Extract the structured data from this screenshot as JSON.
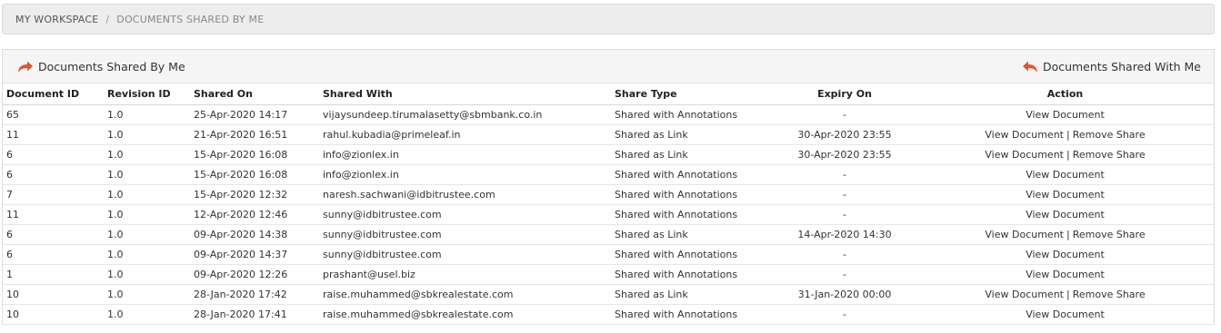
{
  "breadcrumb": {
    "home": "MY WORKSPACE",
    "separator": "/",
    "current": "DOCUMENTS SHARED BY ME"
  },
  "header": {
    "left_label": "Documents Shared By Me",
    "right_label": "Documents Shared With Me",
    "left_icon": "share-forward-icon",
    "right_icon": "share-back-icon",
    "icon_color": "#e8532b"
  },
  "table": {
    "columns": [
      "Document ID",
      "Revision ID",
      "Shared On",
      "Shared With",
      "Share Type",
      "Expiry On",
      "Action"
    ],
    "rows": [
      {
        "doc_id": "65",
        "rev": "1.0",
        "shared_on": "25-Apr-2020 14:17",
        "shared_with": "vijaysundeep.tirumalasetty@sbmbank.co.in",
        "type": "Shared with Annotations",
        "expiry": "-",
        "actions": [
          "View Document"
        ]
      },
      {
        "doc_id": "11",
        "rev": "1.0",
        "shared_on": "21-Apr-2020 16:51",
        "shared_with": "rahul.kubadia@primeleaf.in",
        "type": "Shared as Link",
        "expiry": "30-Apr-2020 23:55",
        "actions": [
          "View Document",
          "Remove Share"
        ]
      },
      {
        "doc_id": "6",
        "rev": "1.0",
        "shared_on": "15-Apr-2020 16:08",
        "shared_with": "info@zionlex.in",
        "type": "Shared as Link",
        "expiry": "30-Apr-2020 23:55",
        "actions": [
          "View Document",
          "Remove Share"
        ]
      },
      {
        "doc_id": "6",
        "rev": "1.0",
        "shared_on": "15-Apr-2020 16:08",
        "shared_with": "info@zionlex.in",
        "type": "Shared with Annotations",
        "expiry": "-",
        "actions": [
          "View Document"
        ]
      },
      {
        "doc_id": "7",
        "rev": "1.0",
        "shared_on": "15-Apr-2020 12:32",
        "shared_with": "naresh.sachwani@idbitrustee.com",
        "type": "Shared with Annotations",
        "expiry": "-",
        "actions": [
          "View Document"
        ]
      },
      {
        "doc_id": "11",
        "rev": "1.0",
        "shared_on": "12-Apr-2020 12:46",
        "shared_with": "sunny@idbitrustee.com",
        "type": "Shared with Annotations",
        "expiry": "-",
        "actions": [
          "View Document"
        ]
      },
      {
        "doc_id": "6",
        "rev": "1.0",
        "shared_on": "09-Apr-2020 14:38",
        "shared_with": "sunny@idbitrustee.com",
        "type": "Shared as Link",
        "expiry": "14-Apr-2020 14:30",
        "actions": [
          "View Document",
          "Remove Share"
        ]
      },
      {
        "doc_id": "6",
        "rev": "1.0",
        "shared_on": "09-Apr-2020 14:37",
        "shared_with": "sunny@idbitrustee.com",
        "type": "Shared with Annotations",
        "expiry": "-",
        "actions": [
          "View Document"
        ]
      },
      {
        "doc_id": "1",
        "rev": "1.0",
        "shared_on": "09-Apr-2020 12:26",
        "shared_with": "prashant@usel.biz",
        "type": "Shared with Annotations",
        "expiry": "-",
        "actions": [
          "View Document"
        ]
      },
      {
        "doc_id": "10",
        "rev": "1.0",
        "shared_on": "28-Jan-2020 17:42",
        "shared_with": "raise.muhammed@sbkrealestate.com",
        "type": "Shared as Link",
        "expiry": "31-Jan-2020 00:00",
        "actions": [
          "View Document",
          "Remove Share"
        ]
      },
      {
        "doc_id": "10",
        "rev": "1.0",
        "shared_on": "28-Jan-2020 17:41",
        "shared_with": "raise.muhammed@sbkrealestate.com",
        "type": "Shared with Annotations",
        "expiry": "-",
        "actions": [
          "View Document"
        ]
      }
    ],
    "action_separator": "|"
  }
}
